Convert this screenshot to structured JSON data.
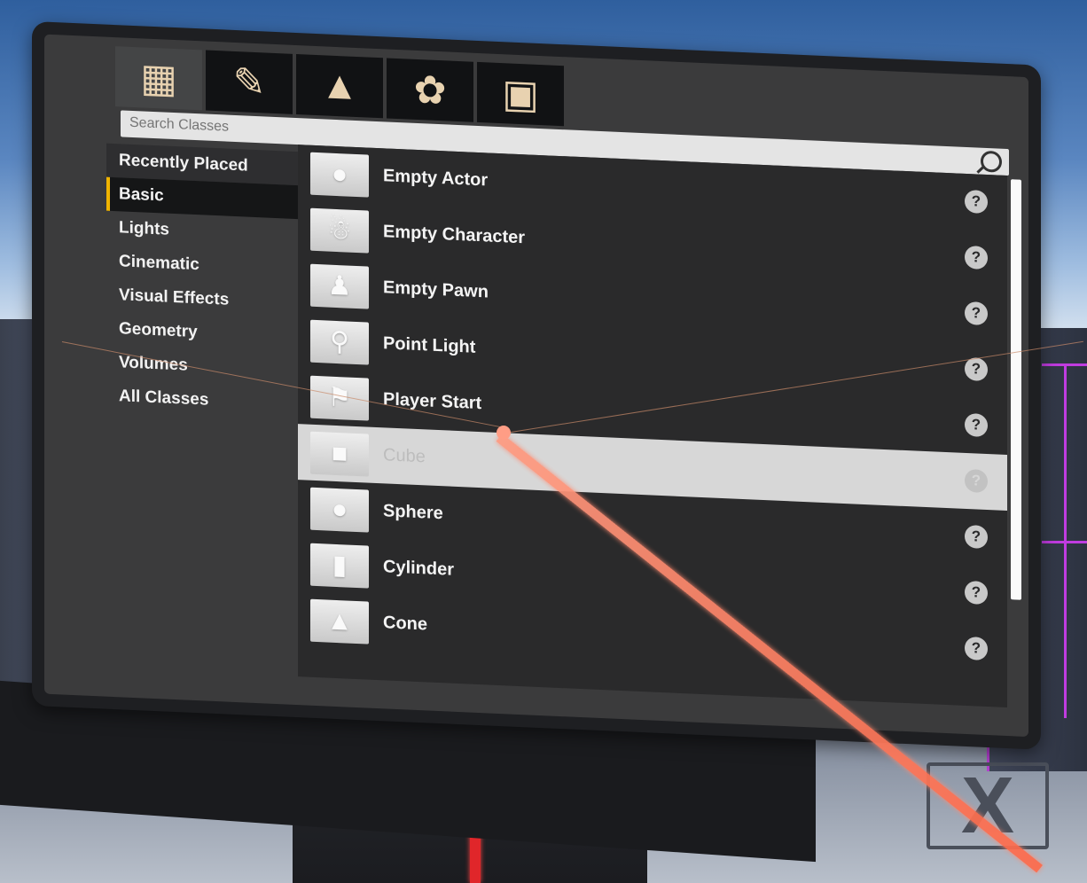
{
  "tabs": [
    {
      "label": "Place",
      "icon": "place-actors-icon",
      "active": true
    },
    {
      "label": "Paint",
      "icon": "paint-brush-icon"
    },
    {
      "label": "Landscape",
      "icon": "landscape-icon"
    },
    {
      "label": "Foliage",
      "icon": "foliage-icon"
    },
    {
      "label": "Geometry Editing",
      "icon": "geometry-edit-icon"
    }
  ],
  "search": {
    "placeholder": "Search Classes"
  },
  "categories": [
    {
      "label": "Recently Placed"
    },
    {
      "label": "Basic",
      "active": true
    },
    {
      "label": "Lights"
    },
    {
      "label": "Cinematic"
    },
    {
      "label": "Visual Effects"
    },
    {
      "label": "Geometry"
    },
    {
      "label": "Volumes"
    },
    {
      "label": "All Classes"
    }
  ],
  "items": [
    {
      "label": "Empty Actor",
      "icon": "sphere-icon"
    },
    {
      "label": "Empty Character",
      "icon": "character-icon"
    },
    {
      "label": "Empty Pawn",
      "icon": "pawn-icon"
    },
    {
      "label": "Point Light",
      "icon": "bulb-icon"
    },
    {
      "label": "Player Start",
      "icon": "player-start-icon"
    },
    {
      "label": "Cube",
      "icon": "cube-icon",
      "selected": true
    },
    {
      "label": "Sphere",
      "icon": "sphere-icon"
    },
    {
      "label": "Cylinder",
      "icon": "cylinder-icon"
    },
    {
      "label": "Cone",
      "icon": "cone-icon"
    }
  ],
  "glyphs": {
    "help": "?",
    "close": "X"
  },
  "colors": {
    "accent": "#f0b400",
    "laser": "#ff6a4a",
    "panel": "#3b3b3c",
    "list_bg": "#2a2a2b",
    "selected_row": "#d7d7d7"
  }
}
